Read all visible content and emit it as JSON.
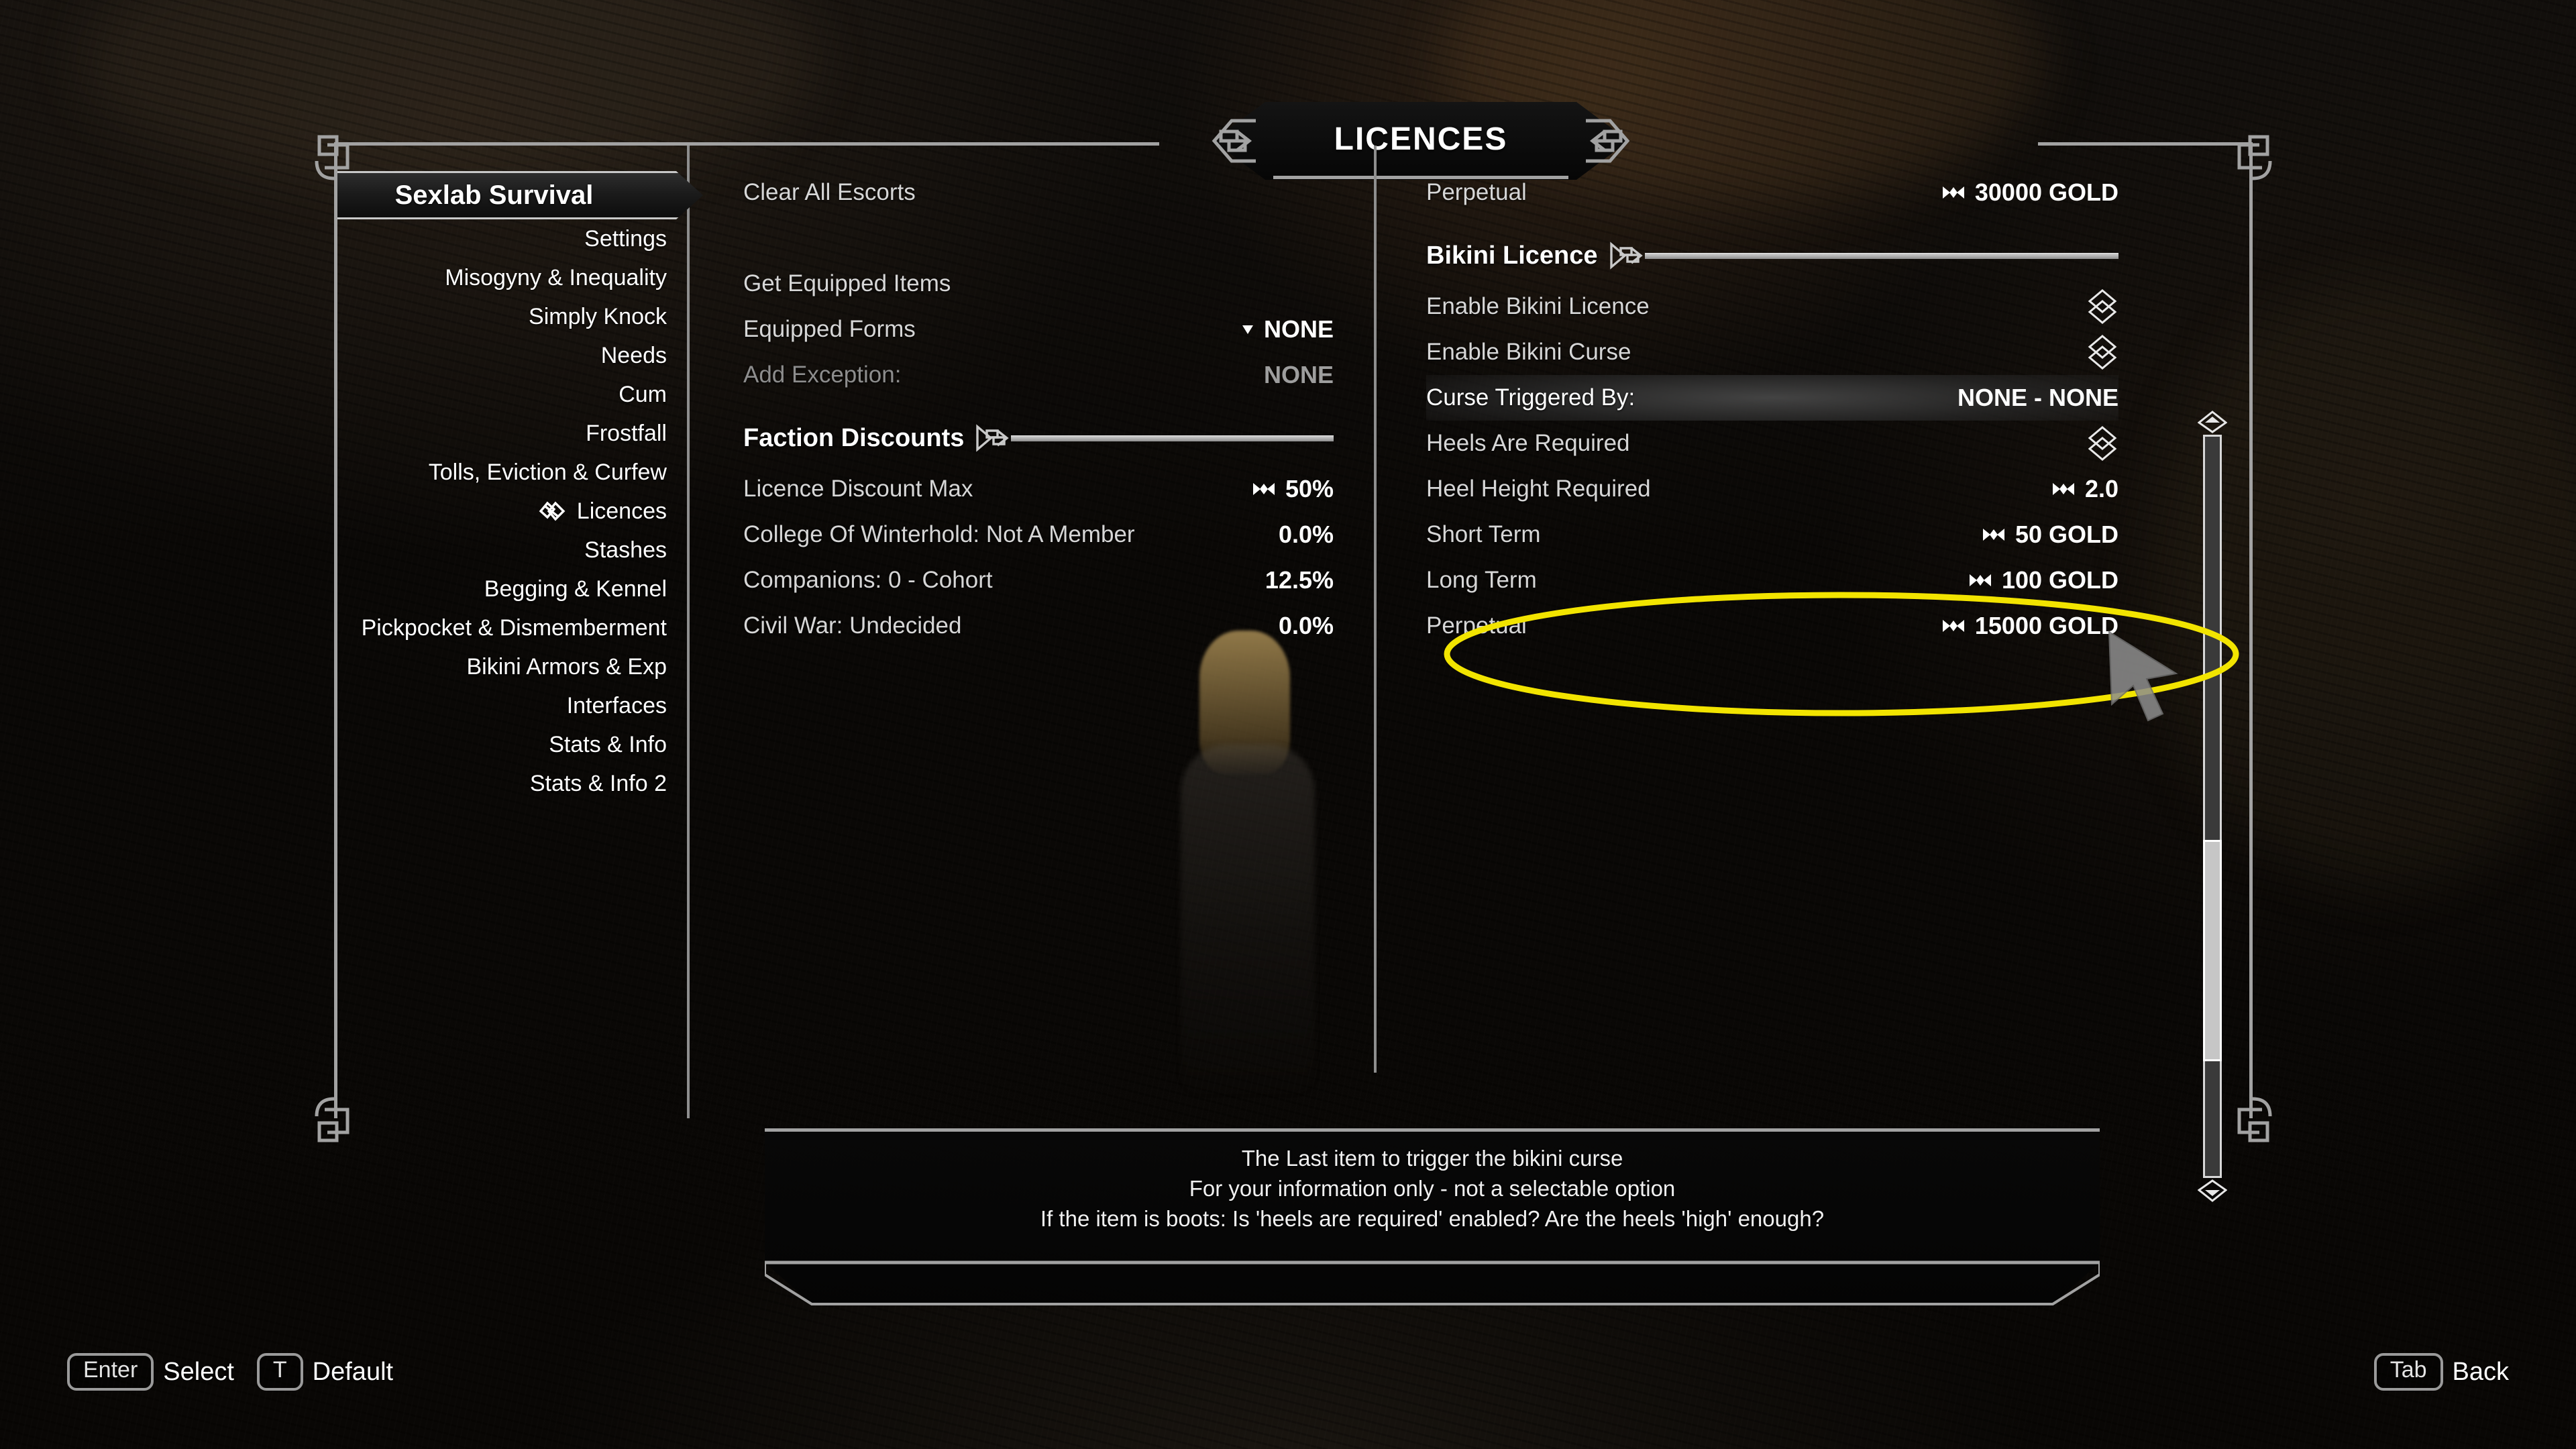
{
  "window": {
    "title": "LICENCES"
  },
  "sidebar": {
    "items": [
      {
        "label": "Sexlab Survival",
        "selected": true,
        "icon": ""
      },
      {
        "label": "Settings",
        "selected": false,
        "icon": ""
      },
      {
        "label": "Misogyny & Inequality",
        "selected": false,
        "icon": ""
      },
      {
        "label": "Simply Knock",
        "selected": false,
        "icon": ""
      },
      {
        "label": "Needs",
        "selected": false,
        "icon": ""
      },
      {
        "label": "Cum",
        "selected": false,
        "icon": ""
      },
      {
        "label": "Frostfall",
        "selected": false,
        "icon": ""
      },
      {
        "label": "Tolls, Eviction & Curfew",
        "selected": false,
        "icon": ""
      },
      {
        "label": "Licences",
        "selected": false,
        "icon": "knot-icon"
      },
      {
        "label": "Stashes",
        "selected": false,
        "icon": ""
      },
      {
        "label": "Begging & Kennel",
        "selected": false,
        "icon": ""
      },
      {
        "label": "Pickpocket & Dismemberment",
        "selected": false,
        "icon": ""
      },
      {
        "label": "Bikini Armors & Exp",
        "selected": false,
        "icon": ""
      },
      {
        "label": "Interfaces",
        "selected": false,
        "icon": ""
      },
      {
        "label": "Stats & Info",
        "selected": false,
        "icon": ""
      },
      {
        "label": "Stats & Info 2",
        "selected": false,
        "icon": ""
      }
    ]
  },
  "left_column": {
    "rows": [
      {
        "label": "Clear All Escorts",
        "value": "",
        "kind": "button",
        "dim": false
      },
      {
        "label": "",
        "value": "",
        "kind": "spacer",
        "dim": false
      },
      {
        "label": "Get Equipped Items",
        "value": "",
        "kind": "button",
        "dim": false
      },
      {
        "label": "Equipped Forms",
        "value": "NONE",
        "kind": "menu",
        "dim": false
      },
      {
        "label": "Add Exception:",
        "value": "NONE",
        "kind": "text",
        "dim": true
      }
    ],
    "section": {
      "title": "Faction Discounts",
      "rows": [
        {
          "label": "Licence Discount Max",
          "value": "50%",
          "kind": "slider",
          "dim": false
        },
        {
          "label": "College Of Winterhold: Not A Member",
          "value": "0.0%",
          "kind": "text",
          "dim": false
        },
        {
          "label": "Companions: 0 - Cohort",
          "value": "12.5%",
          "kind": "text",
          "dim": false
        },
        {
          "label": "Civil War: Undecided",
          "value": "0.0%",
          "kind": "text",
          "dim": false
        }
      ]
    }
  },
  "right_column": {
    "top_rows": [
      {
        "label": "Perpetual",
        "value": "30000 GOLD",
        "kind": "slider",
        "dim": false
      }
    ],
    "section": {
      "title": "Bikini Licence",
      "rows": [
        {
          "label": "Enable Bikini Licence",
          "value": "",
          "kind": "checkbox",
          "dim": false
        },
        {
          "label": "Enable Bikini Curse",
          "value": "",
          "kind": "checkbox",
          "dim": false
        },
        {
          "label": "Curse Triggered By:",
          "value": "NONE  - NONE",
          "kind": "text",
          "dim": false,
          "highlighted": true
        },
        {
          "label": "Heels Are Required",
          "value": "",
          "kind": "checkbox",
          "dim": false
        },
        {
          "label": "Heel Height Required",
          "value": "2.0",
          "kind": "slider",
          "dim": false
        },
        {
          "label": "Short Term",
          "value": "50 GOLD",
          "kind": "slider",
          "dim": false
        },
        {
          "label": "Long Term",
          "value": "100 GOLD",
          "kind": "slider",
          "dim": false
        },
        {
          "label": "Perpetual",
          "value": "15000 GOLD",
          "kind": "slider",
          "dim": false
        }
      ]
    }
  },
  "footer": {
    "lines": [
      "The Last item to trigger the bikini curse",
      "For your information only - not a selectable option",
      "If the item is boots: Is 'heels are required' enabled? Are the heels 'high' enough?"
    ]
  },
  "keybar": {
    "left": [
      {
        "key": "Enter",
        "action": "Select"
      },
      {
        "key": "T",
        "action": "Default"
      }
    ],
    "right": [
      {
        "key": "Tab",
        "action": "Back"
      }
    ]
  },
  "annotation": {
    "color": "#f2e400",
    "shape": "ellipse",
    "target": "Curse Triggered By:"
  },
  "colors": {
    "frame": "#a2a2a2",
    "text": "#e8e8e8",
    "value": "#ffffff",
    "dim": "#8d8d8d",
    "highlight": "#f2e400"
  }
}
